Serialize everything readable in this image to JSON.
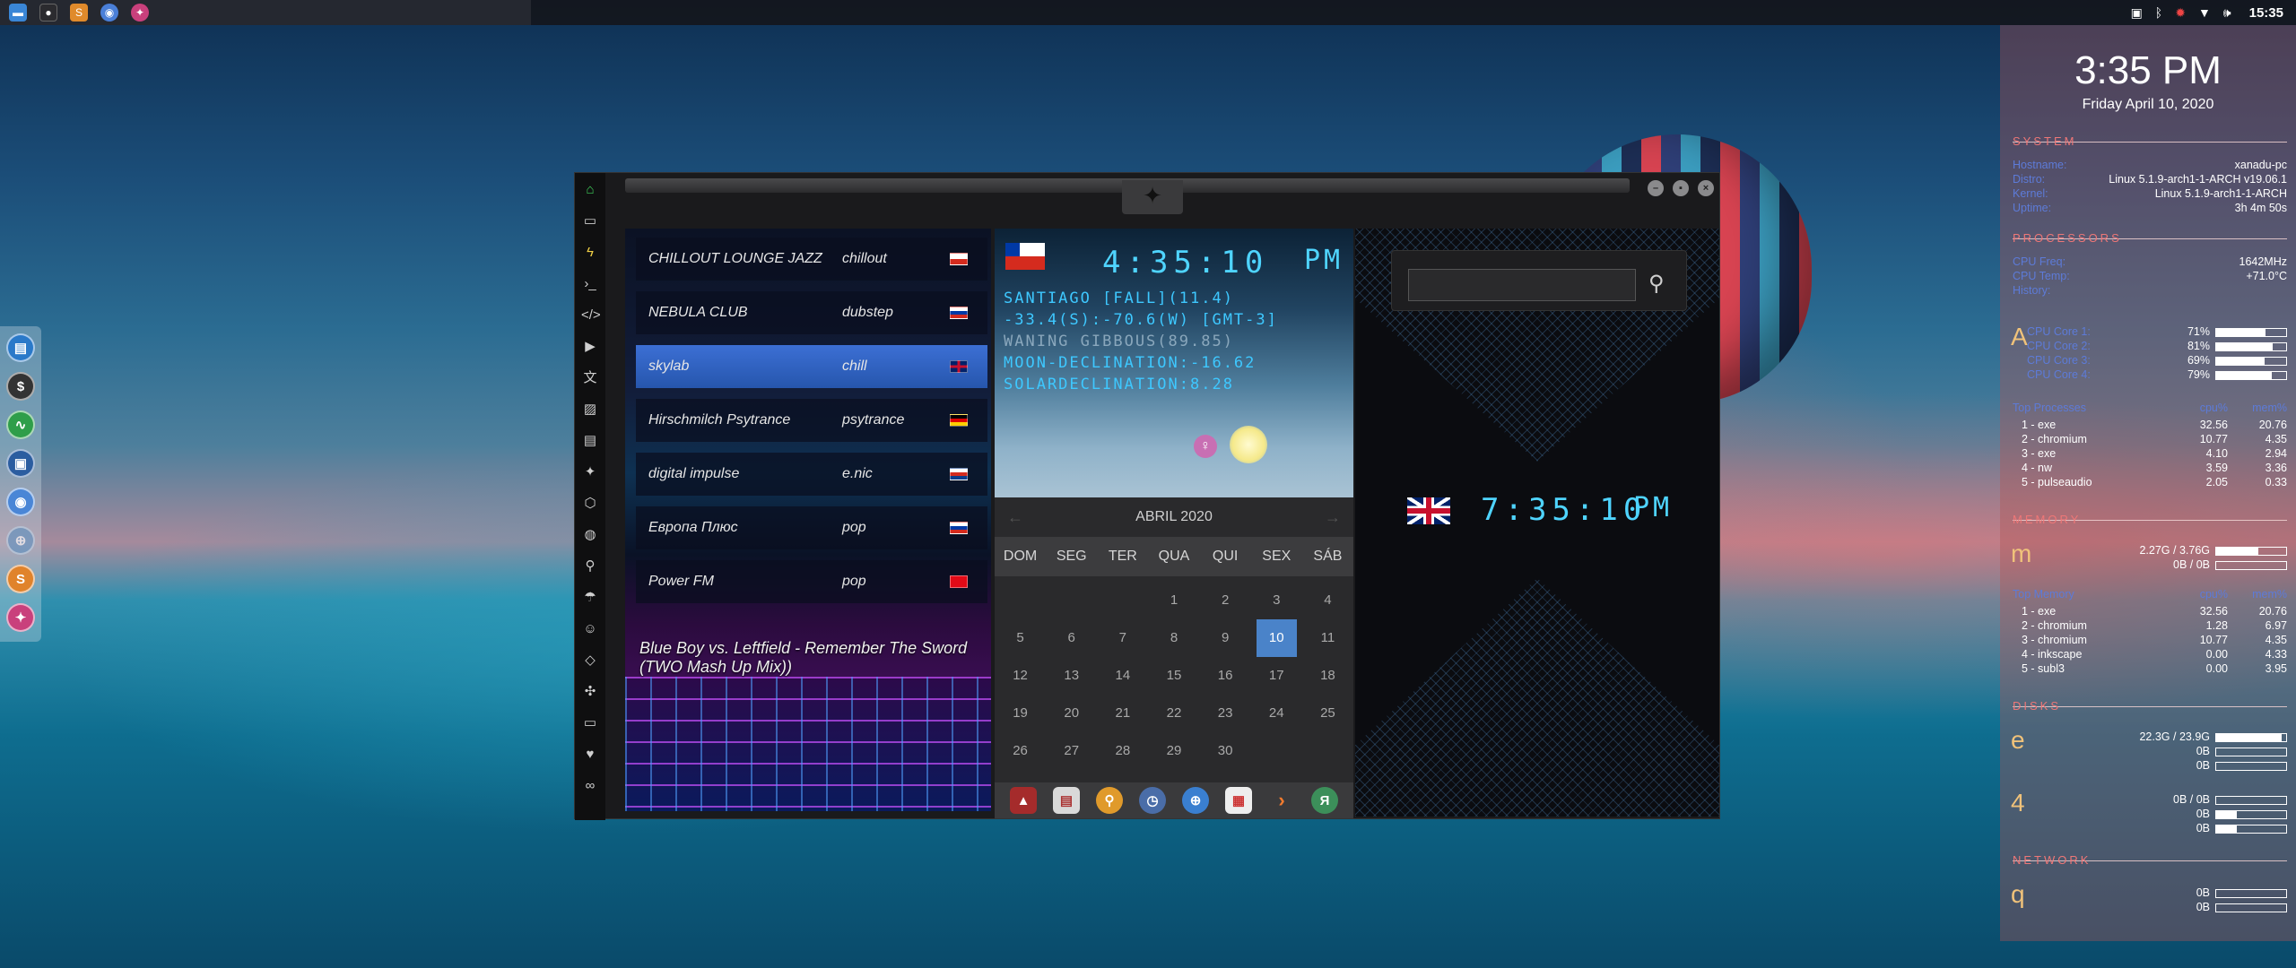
{
  "taskbar": {
    "apps": [
      "file-manager",
      "terminal",
      "sublime-text",
      "chromium",
      "rebel-app"
    ],
    "tray_icons": [
      "screenshot-icon",
      "bluetooth-icon",
      "settings-icon",
      "wifi-icon",
      "volume-icon"
    ],
    "clock": "15:35"
  },
  "dock": {
    "items": [
      "files-icon",
      "money-icon",
      "activity-icon",
      "screenshot-icon",
      "chromium-icon",
      "globe-icon",
      "sublime-icon",
      "rebel-icon"
    ]
  },
  "radio": {
    "stations": [
      {
        "name": "CHILLOUT LOUNGE JAZZ",
        "genre": "chillout",
        "flag_colors": [
          "#ffffff",
          "#d52b1e"
        ]
      },
      {
        "name": "NEBULA CLUB",
        "genre": "dubstep",
        "flag_colors": [
          "#ffffff",
          "#0039a6",
          "#d52b1e"
        ]
      },
      {
        "name": "skylab",
        "genre": "chill",
        "flag_colors": [
          "uk"
        ]
      },
      {
        "name": "Hirschmilch Psytrance",
        "genre": "psytrance",
        "flag_colors": [
          "#000000",
          "#dd0000",
          "#ffce00"
        ]
      },
      {
        "name": "digital impulse",
        "genre": "e.nic",
        "flag_colors": [
          "#ffffff",
          "#d52b1e",
          "#0c3d8c"
        ]
      },
      {
        "name": "Европа Плюс",
        "genre": "pop",
        "flag_colors": [
          "#ffffff",
          "#0039a6",
          "#d52b1e"
        ]
      },
      {
        "name": "Power FM",
        "genre": "pop",
        "flag_colors": [
          "#e30a17"
        ]
      }
    ],
    "now_playing": "Blue Boy vs. Leftfield - Remember The Sword (TWO Mash Up Mix))"
  },
  "chile_clock": {
    "time": "4:35:10",
    "ampm": "PM",
    "lines": [
      "SANTIAGO [FALL](11.4)",
      "-33.4(S):-70.6(W) [GMT-3]",
      "WANING GIBBOUS(89.85)",
      "MOON-DECLINATION:-16.62",
      "SOLARDECLINATION:8.28"
    ]
  },
  "calendar": {
    "month": "ABRIL 2020",
    "weekdays": [
      "DOM",
      "SEG",
      "TER",
      "QUA",
      "QUI",
      "SEX",
      "SÁB"
    ],
    "leading_blanks": 3,
    "days": 30,
    "today": 10
  },
  "bottom_apps": [
    "vlc-icon",
    "news-icon",
    "search-app-icon",
    "clock-app-icon",
    "browser-icon",
    "calendar-app-icon",
    "arrow-app-icon",
    "yandex-icon"
  ],
  "uk_clock": {
    "time": "7:35:10",
    "ampm": "PM",
    "search_placeholder": ""
  },
  "conky": {
    "time": "3:35 PM",
    "date": "Friday April 10, 2020",
    "system_title": "SYSTEM",
    "system": [
      {
        "k": "Hostname:",
        "v": "xanadu-pc"
      },
      {
        "k": "Distro:",
        "v": "Linux 5.1.9-arch1-1-ARCH v19.06.1"
      },
      {
        "k": "Kernel:",
        "v": "Linux 5.1.9-arch1-1-ARCH"
      },
      {
        "k": "Uptime:",
        "v": "3h 4m 50s"
      }
    ],
    "processors_title": "PROCESSORS",
    "processors": [
      {
        "k": "CPU Freq:",
        "v": "1642MHz"
      },
      {
        "k": "CPU Temp:",
        "v": "+71.0°C"
      },
      {
        "k": "History:",
        "v": ""
      }
    ],
    "cores": [
      {
        "k": "CPU Core 1:",
        "v": "71%",
        "pct": 71
      },
      {
        "k": "CPU Core 2:",
        "v": "81%",
        "pct": 81
      },
      {
        "k": "CPU Core 3:",
        "v": "69%",
        "pct": 69
      },
      {
        "k": "CPU Core 4:",
        "v": "79%",
        "pct": 79
      }
    ],
    "cpu_glyph": "A",
    "top_cpu": [
      {
        "n": "1 - exe",
        "c": "32.56",
        "m": "20.76"
      },
      {
        "n": "2 - chromium",
        "c": "10.77",
        "m": "4.35"
      },
      {
        "n": "3 - exe",
        "c": "4.10",
        "m": "2.94"
      },
      {
        "n": "4 - nw",
        "c": "3.59",
        "m": "3.36"
      },
      {
        "n": "5 - pulseaudio",
        "c": "2.05",
        "m": "0.33"
      }
    ],
    "memory_glyph": "m",
    "memory": [
      {
        "v": "2.27G / 3.76G",
        "pct": 60
      },
      {
        "v": "0B / 0B",
        "pct": 0
      }
    ],
    "top_mem": [
      {
        "n": "1 - exe",
        "c": "32.56",
        "m": "20.76"
      },
      {
        "n": "2 - chromium",
        "c": "1.28",
        "m": "6.97"
      },
      {
        "n": "3 - chromium",
        "c": "10.77",
        "m": "4.35"
      },
      {
        "n": "4 - inkscape",
        "c": "0.00",
        "m": "4.33"
      },
      {
        "n": "5 - subl3",
        "c": "0.00",
        "m": "3.95"
      }
    ],
    "disk_glyph": "e",
    "disk": [
      {
        "v": "22.3G / 23.9G",
        "pct": 93
      },
      {
        "v": "0B",
        "pct": 0
      },
      {
        "v": "0B",
        "pct": 0
      }
    ],
    "disk2_glyph": "4",
    "disk2": [
      {
        "v": "0B / 0B",
        "pct": 0
      },
      {
        "v": "0B",
        "pct": 30
      },
      {
        "v": "0B",
        "pct": 30
      }
    ],
    "network_title": "NETWORK",
    "network_glyph": "q",
    "network": [
      {
        "v": "0B",
        "pct": 0
      },
      {
        "v": "0B",
        "pct": 0
      }
    ]
  }
}
